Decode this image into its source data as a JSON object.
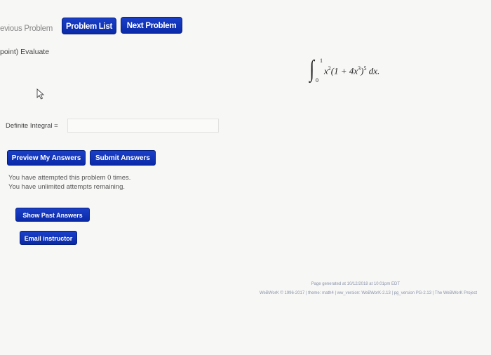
{
  "nav": {
    "previous_label": "evious Problem",
    "problem_list_label": "Problem List",
    "next_label": "Next Problem"
  },
  "problem": {
    "points_prompt": "point) Evaluate",
    "integral": {
      "upper_limit": "1",
      "lower_limit": "0",
      "integrand_pre": "x",
      "integrand_exp1": "2",
      "integrand_mid": "(1 + 4x",
      "integrand_exp2": "3",
      "integrand_close": ")",
      "integrand_exp3": "5",
      "differential": " dx."
    }
  },
  "answer": {
    "label": "Definite Integral =",
    "value": "",
    "placeholder": ""
  },
  "actions": {
    "preview_label": "Preview My Answers",
    "submit_label": "Submit Answers",
    "show_past_label": "Show Past Answers",
    "email_label": "Email instructor"
  },
  "status": {
    "attempted": "You have attempted this problem 0 times.",
    "remaining": "You have unlimited attempts remaining."
  },
  "footer": {
    "generated": "Page generated at 10/12/2018 at 10:01pm EDT",
    "credits": "WeBWorK © 1996-2017 | theme: math4 | ww_version: WeBWorK-2.13 | pg_version PG-2.13 | The WeBWorK Project"
  },
  "colors": {
    "button_blue": "#0d2eb2",
    "background": "#f7f7f6"
  }
}
